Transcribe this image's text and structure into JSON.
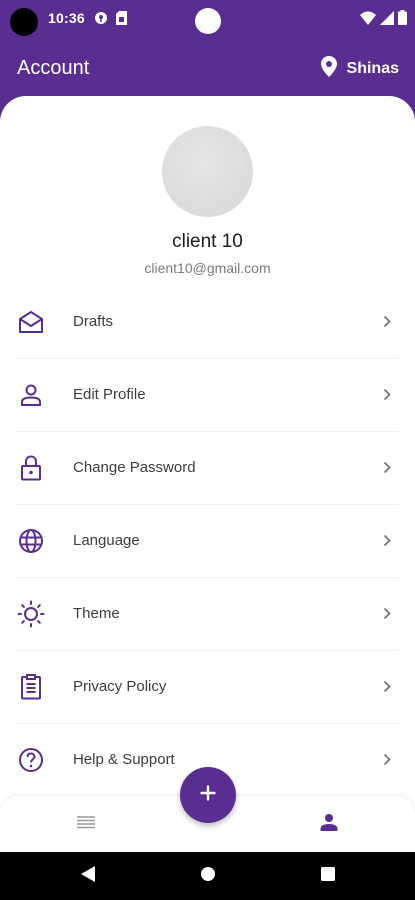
{
  "status_bar": {
    "time": "10:36",
    "left_icons": [
      "vpn-key-icon",
      "sim-card-icon"
    ],
    "right_icons": [
      "wifi-icon",
      "signal-icon",
      "battery-icon"
    ]
  },
  "appbar": {
    "title": "Account",
    "location_icon": "location-pin-icon",
    "location": "Shinas"
  },
  "profile": {
    "name": "client 10",
    "email": "client10@gmail.com"
  },
  "menu": {
    "items": [
      {
        "label": "Drafts",
        "icon": "envelope-open-icon"
      },
      {
        "label": "Edit Profile",
        "icon": "person-icon"
      },
      {
        "label": "Change Password",
        "icon": "lock-icon"
      },
      {
        "label": "Language",
        "icon": "globe-icon"
      },
      {
        "label": "Theme",
        "icon": "sun-icon"
      },
      {
        "label": "Privacy Policy",
        "icon": "clipboard-icon"
      },
      {
        "label": "Help & Support",
        "icon": "help-circle-icon"
      }
    ]
  },
  "bottom_nav": {
    "items": [
      "menu-list-icon",
      "profile-icon"
    ],
    "fab_icon": "plus-icon",
    "active": "profile-icon"
  },
  "system_nav": [
    "back-icon",
    "home-icon",
    "recents-icon"
  ],
  "colors": {
    "primary": "#5a2d91",
    "background": "#ffffff",
    "text": "#3c3c3c",
    "muted": "#7a7a7a"
  }
}
